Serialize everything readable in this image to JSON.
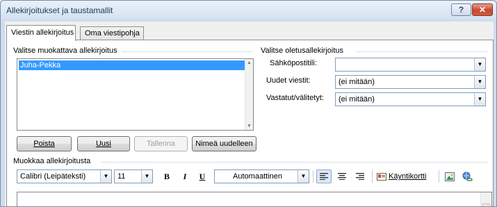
{
  "window": {
    "title": "Allekirjoitukset ja taustamallit",
    "help_label": "?",
    "close_label": "✕"
  },
  "tabs": [
    {
      "label": "Viestin allekirjoitus",
      "active": true
    },
    {
      "label": "Oma viestipohja",
      "active": false
    }
  ],
  "select_signature": {
    "label": "Valitse muokattava allekirjoitus",
    "items": [
      "Juha-Pekka"
    ],
    "selected": "Juha-Pekka"
  },
  "default_signature": {
    "label": "Valitse oletusallekirjoitus",
    "email_account_label": "Sähköpostitili:",
    "email_account_value": "",
    "new_messages_label": "Uudet viestit:",
    "new_messages_value": "(ei mitään)",
    "replies_label": "Vastatut/välitetyt:",
    "replies_value": "(ei mitään)"
  },
  "buttons": {
    "delete": "Poista",
    "new": "Uusi",
    "save": "Tallenna",
    "rename": "Nimeä uudelleen"
  },
  "edit_signature": {
    "label": "Muokkaa allekirjoitusta",
    "font": "Calibri (Leipäteksti)",
    "size": "11",
    "bold": "B",
    "italic": "I",
    "underline": "U",
    "color": "Automaattinen",
    "business_card": "Käyntikortti"
  }
}
